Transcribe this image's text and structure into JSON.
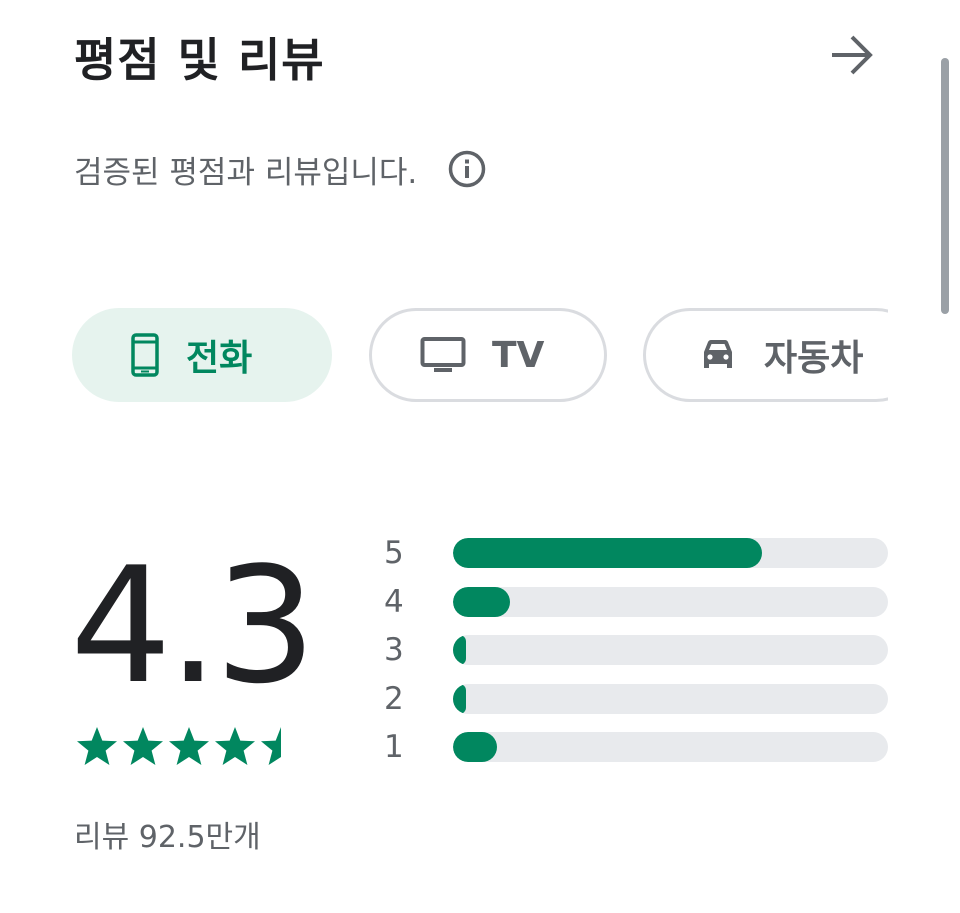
{
  "header": {
    "title": "평점 및 리뷰",
    "arrow_icon": "arrow-right-icon"
  },
  "subtitle": {
    "text": "검증된 평점과 리뷰입니다.",
    "info_icon": "info-icon"
  },
  "device_chips": [
    {
      "label": "전화",
      "icon": "phone-icon",
      "selected": true
    },
    {
      "label": "TV",
      "icon": "tv-icon",
      "selected": false
    },
    {
      "label": "자동차",
      "icon": "car-icon",
      "selected": false
    }
  ],
  "rating": {
    "value": "4.3",
    "stars": 4.3,
    "review_count": "리뷰 92.5만개"
  },
  "distribution": [
    {
      "stars": "5",
      "fraction": 0.71
    },
    {
      "stars": "4",
      "fraction": 0.13
    },
    {
      "stars": "3",
      "fraction": 0.03
    },
    {
      "stars": "2",
      "fraction": 0.03
    },
    {
      "stars": "1",
      "fraction": 0.1
    }
  ],
  "colors": {
    "accent": "#01875f",
    "chip_selected_bg": "#e6f3ee",
    "track": "#e8eaed",
    "text_secondary": "#5f6368"
  }
}
